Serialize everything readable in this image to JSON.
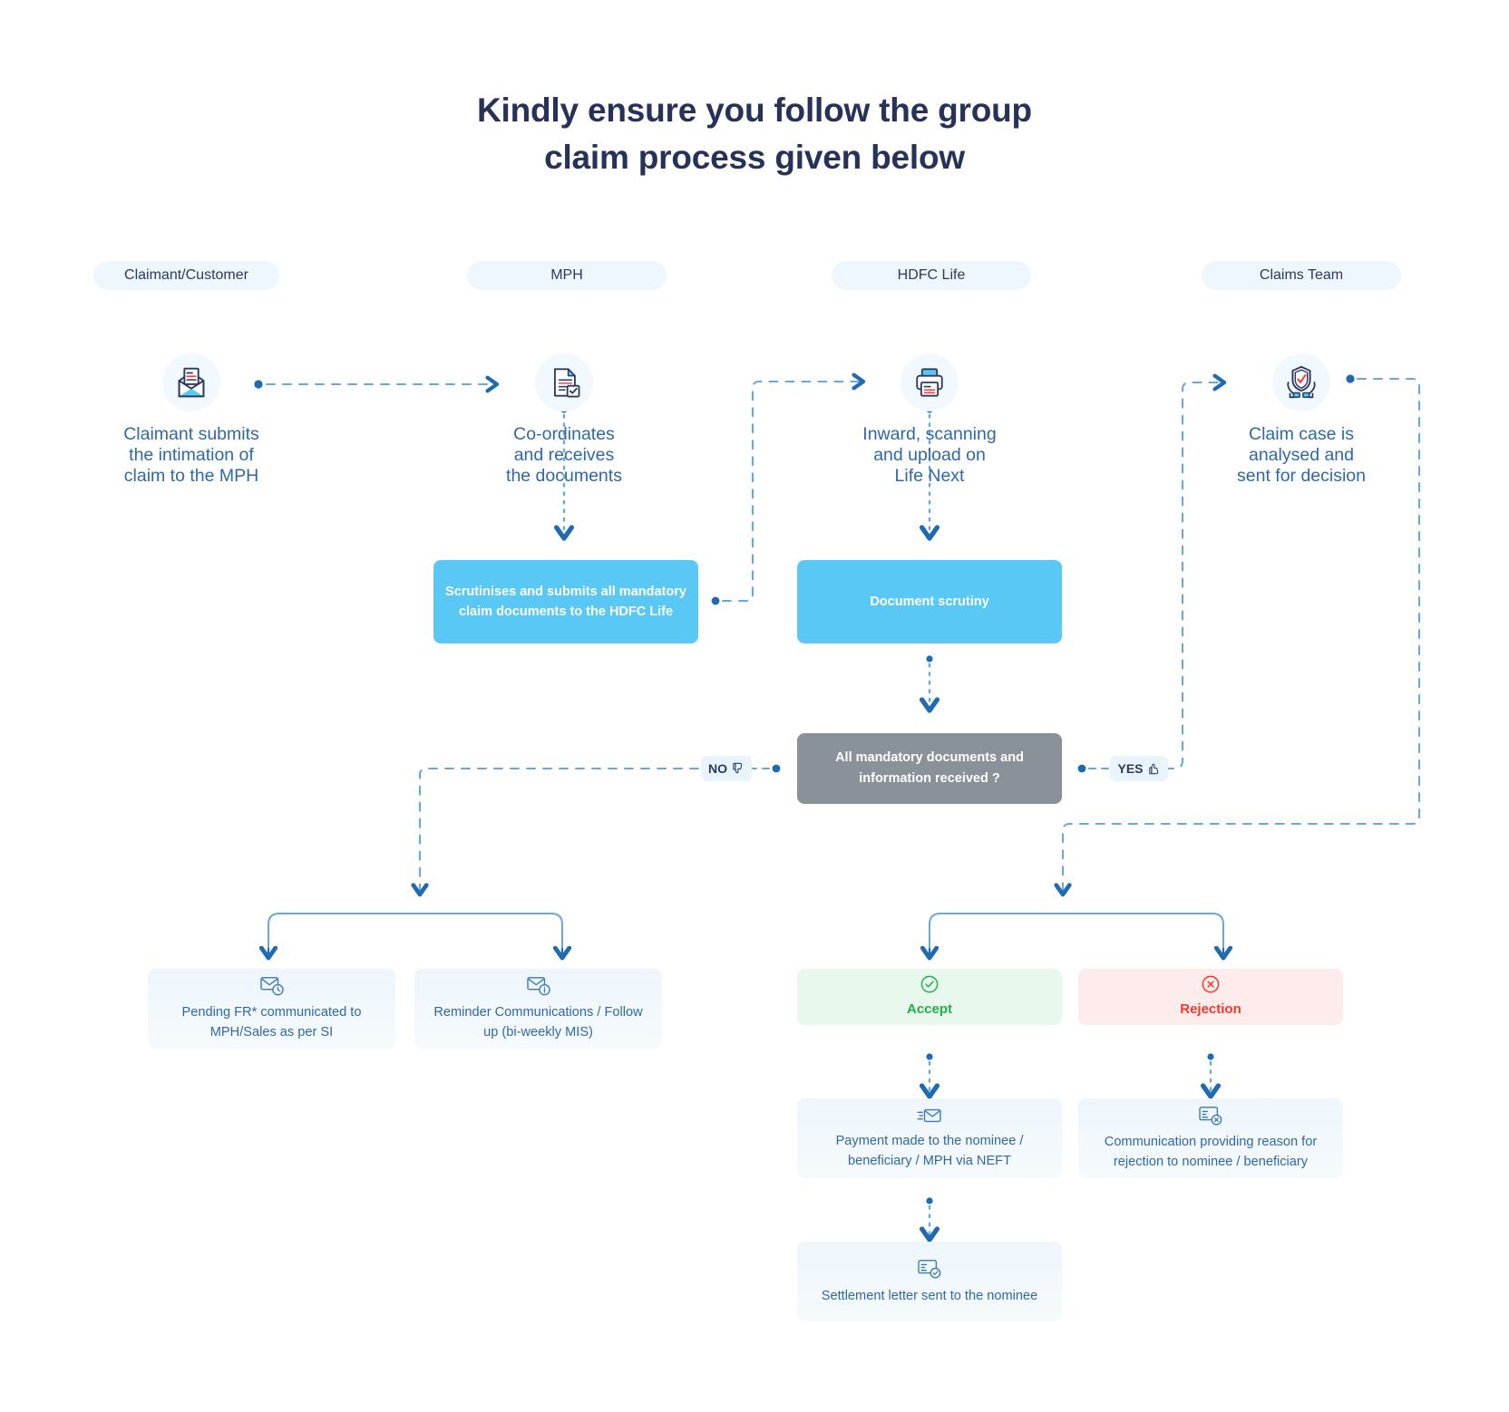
{
  "title": {
    "line1": "Kindly ensure you follow the group",
    "line2": "claim process given below"
  },
  "colors": {
    "title_navy": "#263259",
    "lane_header_bg": "#eef7fd",
    "step_caption_blue": "#2e68a8",
    "cyan_box": "#5ac8f5",
    "gray_box": "#8b9199",
    "accept_green": "#21b04b",
    "accept_bg": "#e8f8ec",
    "reject_red": "#f8372c",
    "reject_bg": "#fdeceb",
    "card_bg": "#eef6fc",
    "connector_blue": "#6aa8d8",
    "connector_dark": "#1f6ab0"
  },
  "lanes": [
    {
      "id": "claimant",
      "label": "Claimant/Customer"
    },
    {
      "id": "mph",
      "label": "MPH"
    },
    {
      "id": "hdfc",
      "label": "HDFC Life"
    },
    {
      "id": "claims",
      "label": "Claims Team"
    }
  ],
  "steps": [
    {
      "id": "claimant-submits",
      "icon": "open-envelope-letter-icon",
      "caption": "Claimant submits\nthe intimation of\nclaim to the MPH"
    },
    {
      "id": "mph-coordinates",
      "icon": "document-check-icon",
      "caption": "Co-ordinates\nand receives\nthe documents"
    },
    {
      "id": "hdfc-inward",
      "icon": "printer-icon",
      "caption": "Inward, scanning\nand upload on\nLife Next"
    },
    {
      "id": "claims-analysed",
      "icon": "shield-check-hands-icon",
      "caption": "Claim case is\nanalysed and\nsent for decision"
    }
  ],
  "process_boxes": [
    {
      "id": "scrutinise-submit",
      "text": "Scrutinises and submits all mandatory claim documents to the HDFC Life",
      "style": "cyan"
    },
    {
      "id": "document-scrutiny",
      "text": "Document scrutiny",
      "style": "cyan"
    }
  ],
  "decision": {
    "id": "mandatory-documents-check",
    "text": "All mandatory documents and information received ?",
    "no_label": "NO",
    "no_icon": "thumbs-down-icon",
    "yes_label": "YES",
    "yes_icon": "thumbs-up-icon"
  },
  "outcome_cards": [
    {
      "id": "pending-fr",
      "icon": "envelope-clock-icon",
      "text": "Pending FR* communicated to MPH/Sales as per SI"
    },
    {
      "id": "reminder-communications",
      "icon": "envelope-info-icon",
      "text": "Reminder Communications / Follow up  (bi-weekly MIS)"
    },
    {
      "id": "accept",
      "icon": "circle-check-icon",
      "text": "Accept"
    },
    {
      "id": "rejection",
      "icon": "circle-cross-icon",
      "text": "Rejection"
    },
    {
      "id": "payment-made",
      "icon": "envelope-send-icon",
      "text": "Payment made to the nominee / beneficiary  / MPH via NEFT"
    },
    {
      "id": "rejection-communication",
      "icon": "document-cross-icon",
      "text": "Communication providing reason for rejection to nominee / beneficiary"
    },
    {
      "id": "settlement-letter",
      "icon": "document-check-small-icon",
      "text": "Settlement letter sent to the nominee"
    }
  ]
}
